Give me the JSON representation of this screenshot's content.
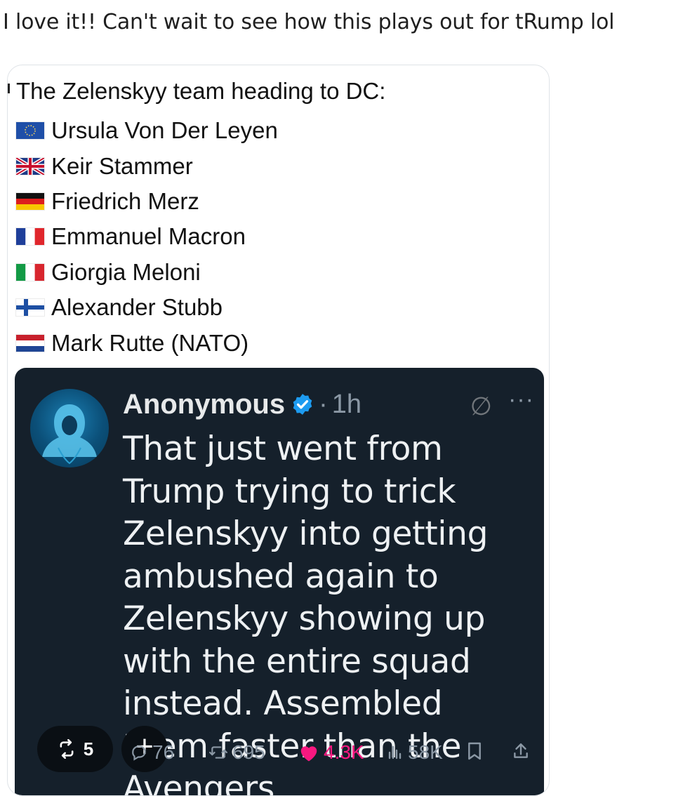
{
  "caption": "I love it!! Can't wait to see how this plays out for tRump lol",
  "post": {
    "intro": "The Zelenskyy team heading to DC:",
    "list": [
      {
        "flag": "eu-flag-icon",
        "name": "Ursula Von Der Leyen"
      },
      {
        "flag": "uk-flag-icon",
        "name": "Keir Stammer"
      },
      {
        "flag": "germany-flag-icon",
        "name": "Friedrich Merz"
      },
      {
        "flag": "france-flag-icon",
        "name": "Emmanuel Macron"
      },
      {
        "flag": "italy-flag-icon",
        "name": "Giorgia Meloni"
      },
      {
        "flag": "finland-flag-icon",
        "name": "Alexander Stubb"
      },
      {
        "flag": "netherlands-flag-icon",
        "name": "Mark Rutte (NATO)"
      }
    ]
  },
  "tweet": {
    "author": "Anonymous",
    "separator": "·",
    "time": "1h",
    "more": "···",
    "text": "That just went from Trump trying to trick Zelenskyy into getting ambushed again to Zelenskyy showing up with the entire squad instead. Assembled them faster than the Avengers.",
    "overlay_repost_count": "5",
    "overlay_plus": "+",
    "replies": "76",
    "reposts": "695",
    "likes": "4.3K",
    "views": "58K"
  },
  "colors": {
    "tweet_bg": "#15202b",
    "verified": "#1d9bf0",
    "like": "#f91880",
    "muted": "#8b98a5"
  }
}
